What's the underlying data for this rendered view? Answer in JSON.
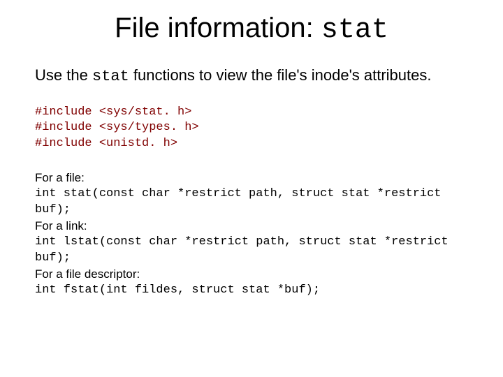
{
  "title_prefix": "File information: ",
  "title_mono": "stat",
  "intro_p1": "Use the ",
  "intro_mono": "stat",
  "intro_p2": " functions to view the file's inode's attributes.",
  "includes": "#include <sys/stat. h>\n#include <sys/types. h>\n#include <unistd. h>",
  "sig1_label": "For a file:",
  "sig1_code": "int stat(const char *restrict path, struct stat *restrict buf);",
  "sig2_label": "For a link:",
  "sig2_code": "int lstat(const char *restrict path, struct stat *restrict buf);",
  "sig3_label": "For a file descriptor:",
  "sig3_code": "int fstat(int fildes, struct stat *buf);"
}
